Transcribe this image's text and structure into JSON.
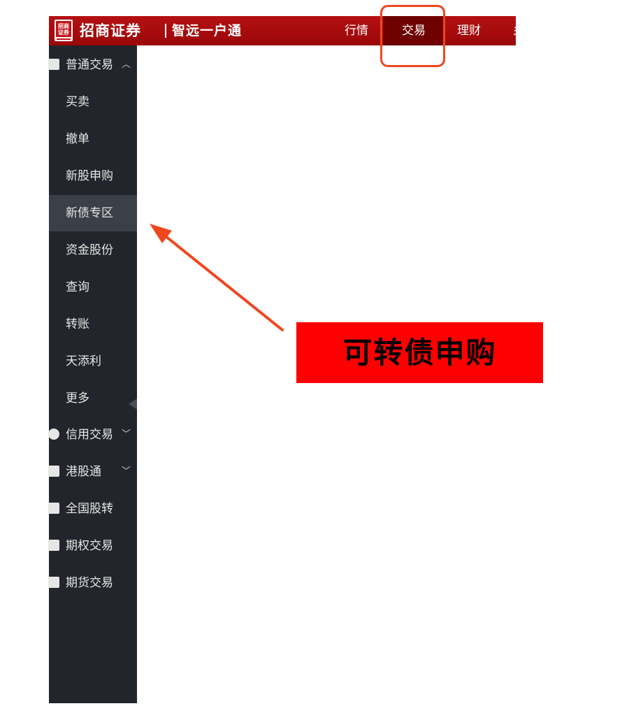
{
  "header": {
    "logo_text": "招商证券",
    "brand": "招商证券",
    "slogan": "智远一户通",
    "tabs": [
      {
        "label": "行情",
        "active": false
      },
      {
        "label": "交易",
        "active": true
      },
      {
        "label": "理财",
        "active": false
      },
      {
        "label": "乡",
        "active": false
      }
    ]
  },
  "sidebar": {
    "groups": [
      {
        "label": "普通交易",
        "chevron": "up",
        "icon": "list-icon",
        "expanded": true
      },
      {
        "label": "信用交易",
        "chevron": "down",
        "icon": "star-icon"
      },
      {
        "label": "港股通",
        "chevron": "down",
        "icon": "hk-icon"
      },
      {
        "label": "全国股转",
        "icon": "cart-icon"
      },
      {
        "label": "期权交易",
        "icon": "option-icon"
      },
      {
        "label": "期货交易",
        "icon": "futures-icon"
      }
    ],
    "items": [
      "买卖",
      "撤单",
      "新股申购",
      "新债专区",
      "资金股份",
      "查询",
      "转账",
      "天添利",
      "更多"
    ],
    "selected_item": "新债专区"
  },
  "annotation": {
    "callout_text": "可转债申购",
    "callout_color": "#ff0000",
    "arrow_color": "#f0461e"
  },
  "colors": {
    "topbar": "#a90c0e",
    "active_tab": "#6e0000",
    "sidebar": "#22252b",
    "selected_item": "#3b3f48"
  }
}
